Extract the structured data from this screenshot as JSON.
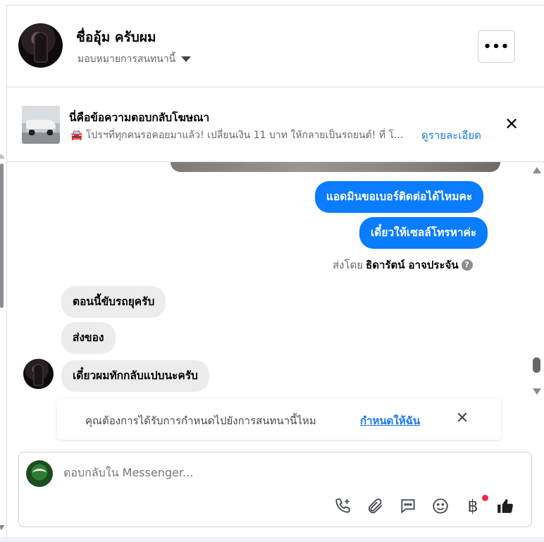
{
  "header": {
    "contact_name": "ชื่ออุ้ม ครับผม",
    "assign_label": "มอบหมายการสนทนานี้",
    "more_label": "•••"
  },
  "ad_reply": {
    "title": "นี่คือข้อความตอบกลับโฆษณา",
    "subtitle": "🚘 โปรฯที่ทุกคนรอคอยมาแล้ว! เปลี่ยนเงิน 11 บาท ให้กลายเป็นรถยนต์! ที่ โ...",
    "details_link": "ดูรายละเอียด",
    "close_label": "✕"
  },
  "messages": {
    "outgoing_1": "แอดมินขอเบอร์ติดต่อได้ไหมคะ",
    "outgoing_2": "เดี๋ยวให้เซลล์โทรหาค่ะ",
    "sent_by_prefix": "ส่งโดย",
    "sent_by_name": "ธิดารัตน์ อาจประจัน",
    "incoming_1": "ตอนนี้ขับรถยุครับ",
    "incoming_2": "ส่งของ",
    "incoming_3": "เดี๋ยวผมทักกลับแปบนะครับ"
  },
  "assign_prompt": {
    "text": "คุณต้องการได้รับการกำหนดไปยังการสนทนานี้ไหม",
    "link": "กำหนดให้ฉัน",
    "close_label": "✕"
  },
  "composer": {
    "placeholder": "ตอบกลับใน Messenger...",
    "currency_symbol": "฿"
  },
  "colors": {
    "outgoing_bubble": "#0a7cff",
    "incoming_bubble": "#ececec",
    "link": "#1877f2",
    "notification_dot": "#f02849"
  },
  "icons": [
    "chevron-down-icon",
    "more-icon",
    "close-icon",
    "car-emoji-icon",
    "help-icon",
    "add-call-icon",
    "attachment-icon",
    "saved-reply-icon",
    "emoji-icon",
    "baht-icon",
    "like-icon"
  ]
}
